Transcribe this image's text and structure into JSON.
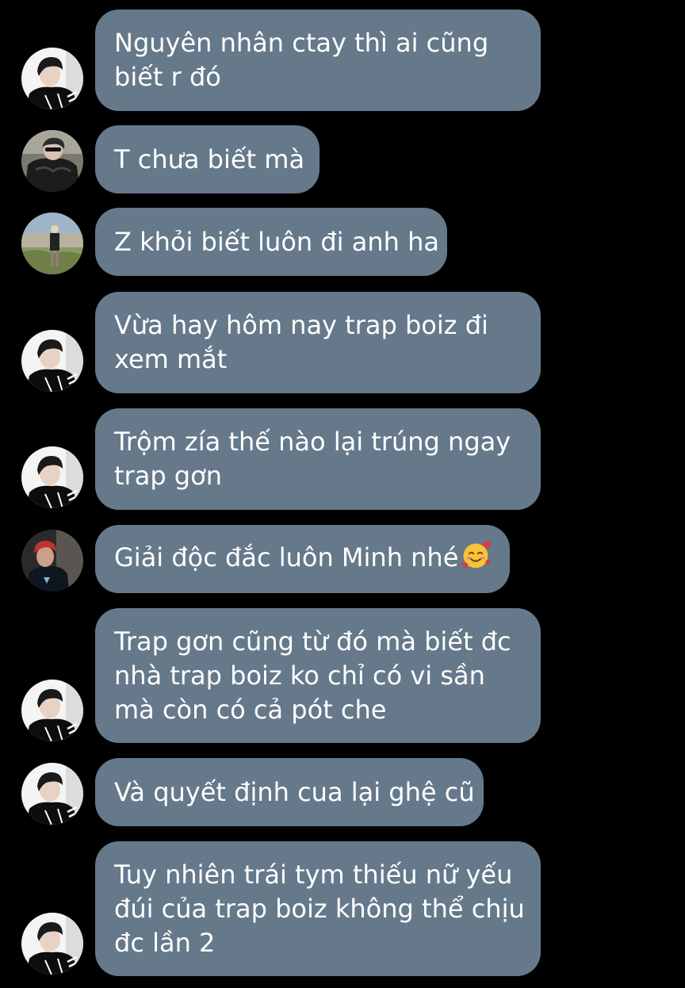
{
  "messages": [
    {
      "lines": [
        "Nguyên nhân ctay thì ai cũng",
        "biết r đó"
      ],
      "avatar": "avatar-boy-profile-icon"
    },
    {
      "lines": [
        "T chưa biết mà"
      ],
      "avatar": "avatar-jacket-person-icon"
    },
    {
      "lines": [
        "Z khỏi biết luôn đi anh ha"
      ],
      "avatar": "avatar-outdoor-person-icon"
    },
    {
      "lines": [
        "Vừa hay hôm nay trap boiz đi",
        "xem mắt"
      ],
      "avatar": "avatar-boy-profile-icon"
    },
    {
      "lines": [
        "Trộm zía thế nào lại trúng ngay",
        "trap gơn"
      ],
      "avatar": "avatar-boy-profile-icon"
    },
    {
      "lines": [
        "Giải độc đắc luôn Minh nhé"
      ],
      "avatar": "avatar-red-hair-icon",
      "emoji": "smiling-face-with-hearts-icon"
    },
    {
      "lines": [
        "Trap gơn cũng từ đó mà biết đc",
        "nhà trap boiz ko chỉ có vi sần",
        "mà còn có cả pót che"
      ],
      "avatar": "avatar-boy-profile-icon"
    },
    {
      "lines": [
        "Và quyết định cua lại ghệ cũ"
      ],
      "avatar": "avatar-boy-profile-icon"
    },
    {
      "lines": [
        "Tuy nhiên trái tym thiếu nữ yếu",
        "đúi của trap boiz không thể chịu",
        "đc lần 2"
      ],
      "avatar": "avatar-boy-profile-icon"
    }
  ],
  "colors": {
    "background": "#000000",
    "bubble": "#65798a",
    "text": "#ffffff"
  }
}
